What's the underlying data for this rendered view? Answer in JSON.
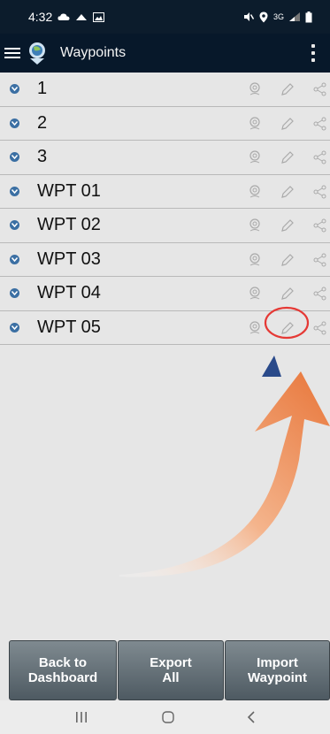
{
  "status_bar": {
    "time": "4:32",
    "network_label": "3G"
  },
  "app_bar": {
    "title": "Waypoints"
  },
  "waypoints": [
    {
      "label": "1"
    },
    {
      "label": "2"
    },
    {
      "label": "3"
    },
    {
      "label": "WPT 01"
    },
    {
      "label": "WPT 02"
    },
    {
      "label": "WPT 03"
    },
    {
      "label": "WPT 04"
    },
    {
      "label": "WPT 05"
    }
  ],
  "buttons": {
    "back_line1": "Back to",
    "back_line2": "Dashboard",
    "export_line1": "Export",
    "export_line2": "All",
    "import_line1": "Import",
    "import_line2": "Waypoint"
  },
  "icons": {
    "row_actions": [
      "locate-icon",
      "pencil-icon",
      "share-icon"
    ],
    "annotation": "red-circle-highlight-and-orange-arrow"
  },
  "colors": {
    "status_bg": "#0c1c2c",
    "app_bar_bg": "#07182a",
    "list_bg": "#e6e6e6",
    "chevron": "#3b6fa3",
    "annotation_red": "#e53935",
    "annotation_orange": "#e8763a"
  }
}
